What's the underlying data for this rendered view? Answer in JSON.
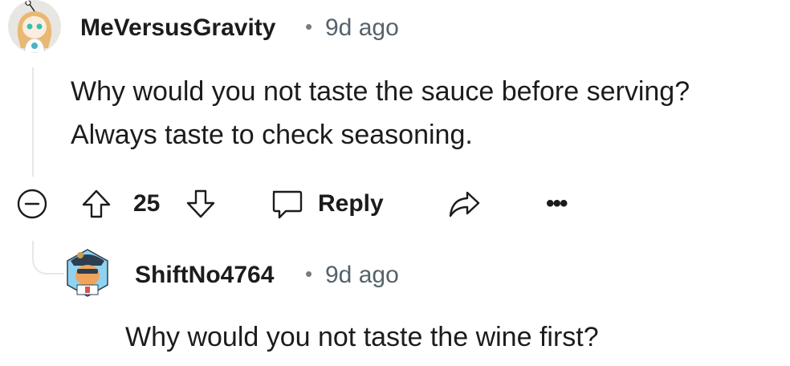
{
  "comment": {
    "author": "MeVersusGravity",
    "separator": "•",
    "time": "9d ago",
    "text_line1": "Why would you not taste the sauce before serving?",
    "text_line2": "Always taste to check seasoning.",
    "votes": "25",
    "reply_label": "Reply",
    "more_label": "•••"
  },
  "reply": {
    "author": "ShiftNo4764",
    "separator": "•",
    "time": "9d ago",
    "text": "Why would you not taste the wine first?"
  }
}
